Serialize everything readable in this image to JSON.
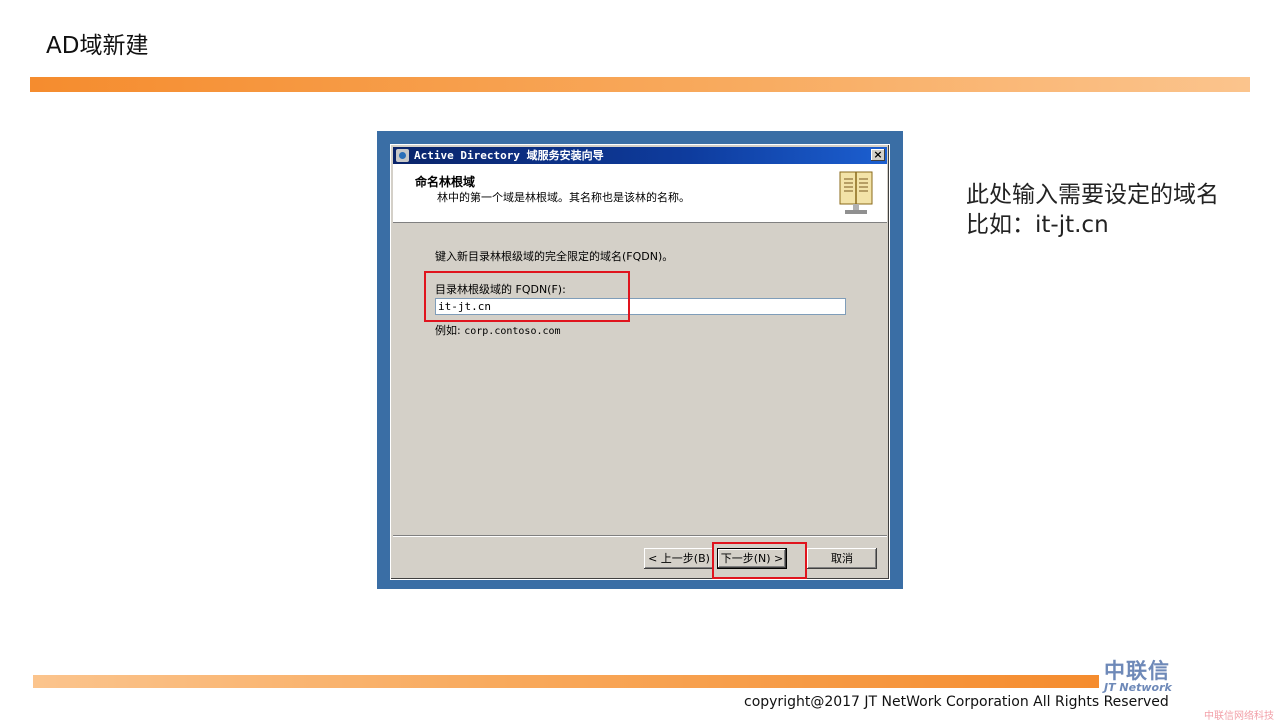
{
  "slide": {
    "title": "AD域新建",
    "annotation_line1": "此处输入需要设定的域名",
    "annotation_line2": "比如：it-jt.cn",
    "copyright": "copyright@2017  JT NetWork Corporation All Rights Reserved",
    "logo_cn": "中联信",
    "logo_en": "JT Network",
    "watermark": "中联信网络科技",
    "highlight_color": "#e0141e"
  },
  "dialog": {
    "title": "Active Directory 域服务安装向导",
    "close_label": "×",
    "header_title": "命名林根域",
    "header_subtitle": "林中的第一个域是林根域。其名称也是该林的名称。",
    "body_text": "键入新目录林根级域的完全限定的域名(FQDN)。",
    "field_label": "目录林根级域的 FQDN(F):",
    "field_value": "it-jt.cn",
    "example_label": "例如:",
    "example_value": "corp.contoso.com",
    "buttons": {
      "back": "< 上一步(B)",
      "next": "下一步(N) >",
      "cancel": "取消"
    }
  }
}
